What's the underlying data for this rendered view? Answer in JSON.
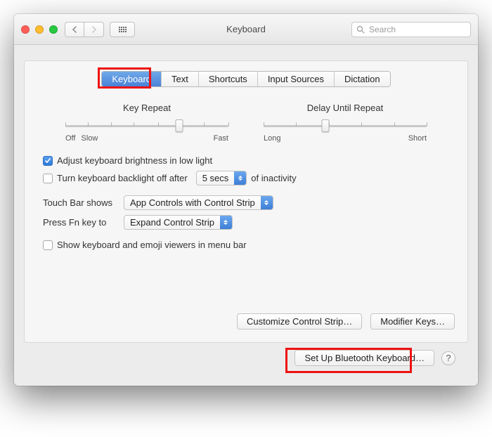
{
  "window": {
    "title": "Keyboard"
  },
  "search": {
    "placeholder": "Search"
  },
  "tabs": [
    "Keyboard",
    "Text",
    "Shortcuts",
    "Input Sources",
    "Dictation"
  ],
  "sliders": {
    "keyRepeat": {
      "label": "Key Repeat",
      "left": "Off",
      "left2": "Slow",
      "right": "Fast"
    },
    "delay": {
      "label": "Delay Until Repeat",
      "left": "Long",
      "right": "Short"
    }
  },
  "checkboxes": {
    "autoBrightness": "Adjust keyboard brightness in low light",
    "backlightOffPrefix": "Turn keyboard backlight off after",
    "backlightOffSuffix": "of inactivity",
    "showViewers": "Show keyboard and emoji viewers in menu bar"
  },
  "selects": {
    "backlightOff": "5 secs",
    "touchBarLabel": "Touch Bar shows",
    "touchBar": "App Controls with Control Strip",
    "fnKeyLabel": "Press Fn key to",
    "fnKey": "Expand Control Strip"
  },
  "buttons": {
    "customize": "Customize Control Strip…",
    "modifier": "Modifier Keys…",
    "bluetooth": "Set Up Bluetooth Keyboard…"
  }
}
